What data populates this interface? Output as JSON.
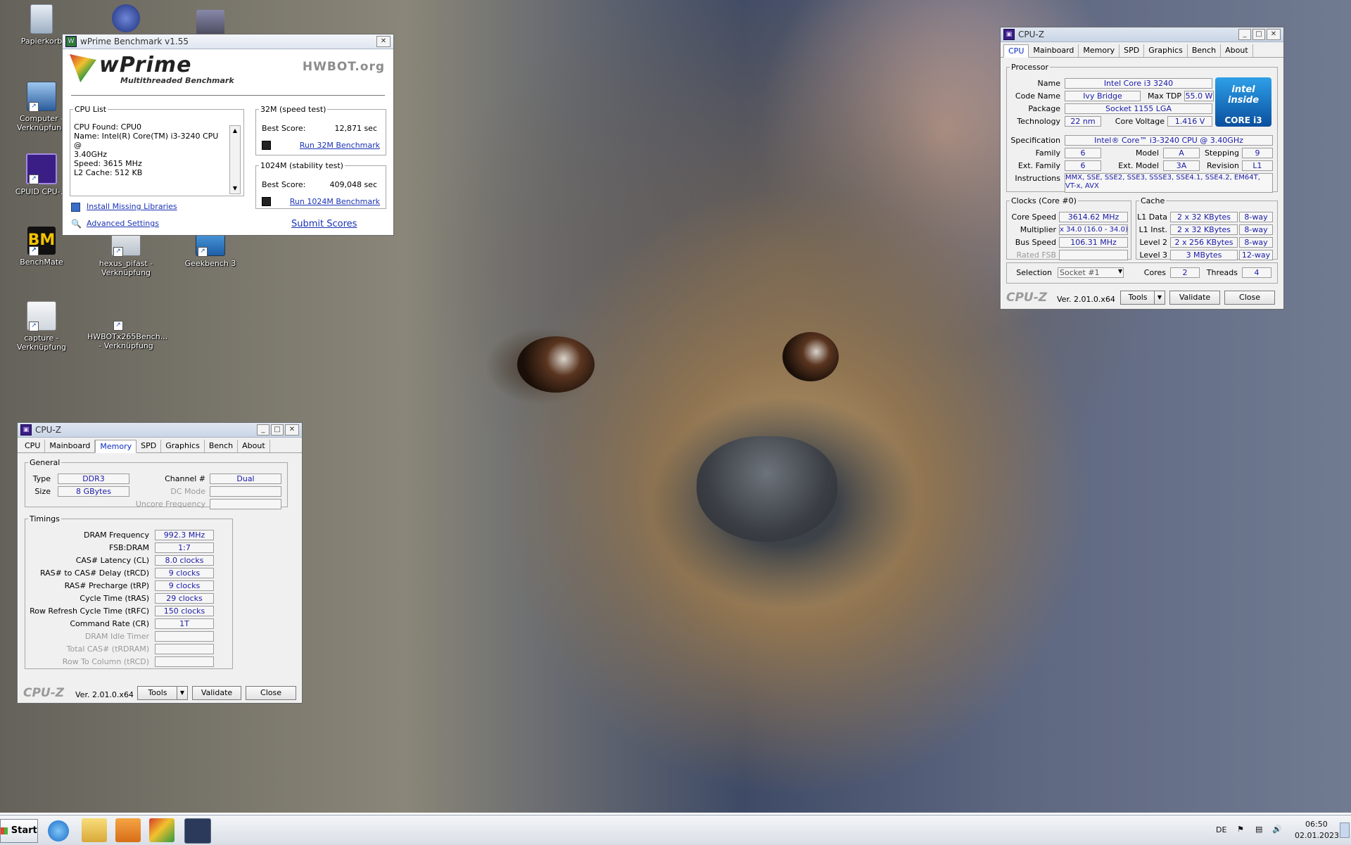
{
  "desktop": {
    "icons": [
      {
        "label": "Papierkorb"
      },
      {
        "label": "Computer - Verknüpfung"
      },
      {
        "label": "CPUID CPU-..."
      },
      {
        "label": "BenchMate"
      },
      {
        "label": "hexus_pifast - Verknüpfung"
      },
      {
        "label": "Geekbench 3"
      },
      {
        "label": "capture - Verknüpfung"
      },
      {
        "label": "HWBOTx265Bench... - Verknüpfung"
      }
    ]
  },
  "wprime": {
    "title": "wPrime Benchmark v1.55",
    "logo": "wPrime",
    "logo_sub": "Multithreaded Benchmark",
    "hwbot_logo": "HWBOT.org",
    "cpu_list": {
      "legend": "CPU List",
      "lines": [
        "CPU Found: CPU0",
        "Name:    Intel(R) Core(TM) i3-3240 CPU @",
        "3.40GHz",
        "Speed:   3615 MHz",
        "L2 Cache:  512 KB"
      ]
    },
    "speed_test": {
      "legend": "32M (speed test)",
      "best_label": "Best Score:",
      "best_value": "12,871 sec",
      "run_label": "Run 32M Benchmark"
    },
    "stability_test": {
      "legend": "1024M (stability test)",
      "best_label": "Best Score:",
      "best_value": "409,048 sec",
      "run_label": "Run 1024M Benchmark"
    },
    "install_libs": "Install Missing Libraries",
    "advanced_settings": "Advanced Settings",
    "submit_scores": "Submit Scores"
  },
  "cpuz_cpu": {
    "title": "CPU-Z",
    "tabs": [
      "CPU",
      "Mainboard",
      "Memory",
      "SPD",
      "Graphics",
      "Bench",
      "About"
    ],
    "processor": {
      "legend": "Processor",
      "name_label": "Name",
      "name": "Intel Core i3 3240",
      "codename_label": "Code Name",
      "codename": "Ivy Bridge",
      "maxtdp_label": "Max TDP",
      "maxtdp": "55.0 W",
      "package_label": "Package",
      "package": "Socket 1155 LGA",
      "technology_label": "Technology",
      "technology": "22 nm",
      "voltage_label": "Core Voltage",
      "voltage": "1.416 V",
      "spec_label": "Specification",
      "spec": "Intel® Core™ i3-3240 CPU @ 3.40GHz",
      "family_label": "Family",
      "family": "6",
      "model_label": "Model",
      "model": "A",
      "stepping_label": "Stepping",
      "stepping": "9",
      "extfamily_label": "Ext. Family",
      "extfamily": "6",
      "extmodel_label": "Ext. Model",
      "extmodel": "3A",
      "revision_label": "Revision",
      "revision": "L1",
      "instructions_label": "Instructions",
      "instructions": "MMX, SSE, SSE2, SSE3, SSSE3, SSE4.1, SSE4.2, EM64T, VT-x, AVX",
      "badge_inside": "intel inside",
      "badge_core": "CORE i3"
    },
    "clocks": {
      "legend": "Clocks (Core #0)",
      "core_speed_label": "Core Speed",
      "core_speed": "3614.62 MHz",
      "multiplier_label": "Multiplier",
      "multiplier": "x 34.0 (16.0 - 34.0)",
      "bus_speed_label": "Bus Speed",
      "bus_speed": "106.31 MHz",
      "rated_fsb_label": "Rated FSB",
      "rated_fsb": ""
    },
    "cache": {
      "legend": "Cache",
      "rows": [
        {
          "label": "L1 Data",
          "size": "2 x 32 KBytes",
          "way": "8-way"
        },
        {
          "label": "L1 Inst.",
          "size": "2 x 32 KBytes",
          "way": "8-way"
        },
        {
          "label": "Level 2",
          "size": "2 x 256 KBytes",
          "way": "8-way"
        },
        {
          "label": "Level 3",
          "size": "3 MBytes",
          "way": "12-way"
        }
      ]
    },
    "selection_label": "Selection",
    "selection": "Socket #1",
    "cores_label": "Cores",
    "cores": "2",
    "threads_label": "Threads",
    "threads": "4",
    "footer": {
      "logo": "CPU-Z",
      "version": "Ver. 2.01.0.x64",
      "tools": "Tools",
      "validate": "Validate",
      "close": "Close"
    }
  },
  "cpuz_mem": {
    "title": "CPU-Z",
    "tabs": [
      "CPU",
      "Mainboard",
      "Memory",
      "SPD",
      "Graphics",
      "Bench",
      "About"
    ],
    "general": {
      "legend": "General",
      "type_label": "Type",
      "type": "DDR3",
      "size_label": "Size",
      "size": "8 GBytes",
      "channel_label": "Channel #",
      "channel": "Dual",
      "dcmode_label": "DC Mode",
      "dcmode": "",
      "uncore_label": "Uncore Frequency",
      "uncore": ""
    },
    "timings": {
      "legend": "Timings",
      "rows": [
        {
          "label": "DRAM Frequency",
          "value": "992.3 MHz",
          "dim": false
        },
        {
          "label": "FSB:DRAM",
          "value": "1:7",
          "dim": false
        },
        {
          "label": "CAS# Latency (CL)",
          "value": "8.0 clocks",
          "dim": false
        },
        {
          "label": "RAS# to CAS# Delay (tRCD)",
          "value": "9 clocks",
          "dim": false
        },
        {
          "label": "RAS# Precharge (tRP)",
          "value": "9 clocks",
          "dim": false
        },
        {
          "label": "Cycle Time (tRAS)",
          "value": "29 clocks",
          "dim": false
        },
        {
          "label": "Row Refresh Cycle Time (tRFC)",
          "value": "150 clocks",
          "dim": false
        },
        {
          "label": "Command Rate (CR)",
          "value": "1T",
          "dim": false
        },
        {
          "label": "DRAM Idle Timer",
          "value": "",
          "dim": true
        },
        {
          "label": "Total CAS# (tRDRAM)",
          "value": "",
          "dim": true
        },
        {
          "label": "Row To Column (tRCD)",
          "value": "",
          "dim": true
        }
      ]
    },
    "footer": {
      "logo": "CPU-Z",
      "version": "Ver. 2.01.0.x64",
      "tools": "Tools",
      "validate": "Validate",
      "close": "Close"
    }
  },
  "taskbar": {
    "start": "Start",
    "language": "DE",
    "time": "06:50",
    "date": "02.01.2023"
  }
}
